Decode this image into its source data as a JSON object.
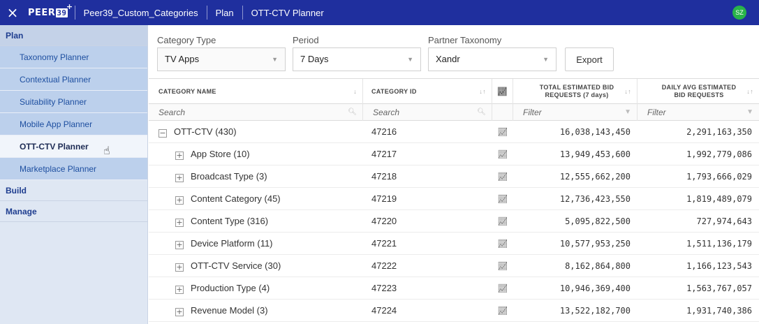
{
  "topbar": {
    "close_icon": "×",
    "logo_text": "PEER",
    "logo_num": "39",
    "logo_sup": "+",
    "crumbs": [
      "Peer39_Custom_Categories",
      "Plan",
      "OTT-CTV Planner"
    ],
    "avatar": "SZ",
    "colors": {
      "bar": "#1f2f9e",
      "avatar": "#29b34a"
    }
  },
  "sidebar": {
    "sections": [
      {
        "label": "Plan"
      },
      {
        "label": "Build"
      },
      {
        "label": "Manage"
      }
    ],
    "plan_items": [
      {
        "label": "Taxonomy Planner"
      },
      {
        "label": "Contextual Planner"
      },
      {
        "label": "Suitability Planner"
      },
      {
        "label": "Mobile App Planner"
      },
      {
        "label": "OTT-CTV Planner",
        "selected": true
      },
      {
        "label": "Marketplace Planner"
      }
    ]
  },
  "filters": {
    "category_type": {
      "label": "Category Type",
      "value": "TV Apps"
    },
    "period": {
      "label": "Period",
      "value": "7 Days"
    },
    "partner": {
      "label": "Partner Taxonomy",
      "value": "Xandr"
    },
    "export_label": "Export"
  },
  "grid": {
    "headers": {
      "name": "CATEGORY NAME",
      "id": "CATEGORY ID",
      "total": "TOTAL ESTIMATED BID REQUESTS (7 days)",
      "daily": "DAILY AVG ESTIMATED BID REQUESTS"
    },
    "placeholders": {
      "name": "Search",
      "id": "Search",
      "total": "Filter",
      "daily": "Filter"
    },
    "rows": [
      {
        "toggle": "−",
        "name": "OTT-CTV (430)",
        "id": "47216",
        "total": "16,038,143,450",
        "daily": "2,291,163,350"
      },
      {
        "toggle": "+",
        "name": "App Store (10)",
        "id": "47217",
        "total": "13,949,453,600",
        "daily": "1,992,779,086"
      },
      {
        "toggle": "+",
        "name": "Broadcast Type (3)",
        "id": "47218",
        "total": "12,555,662,200",
        "daily": "1,793,666,029"
      },
      {
        "toggle": "+",
        "name": "Content Category (45)",
        "id": "47219",
        "total": "12,736,423,550",
        "daily": "1,819,489,079"
      },
      {
        "toggle": "+",
        "name": "Content Type (316)",
        "id": "47220",
        "total": "5,095,822,500",
        "daily": "727,974,643"
      },
      {
        "toggle": "+",
        "name": "Device Platform (11)",
        "id": "47221",
        "total": "10,577,953,250",
        "daily": "1,511,136,179"
      },
      {
        "toggle": "+",
        "name": "OTT-CTV Service (30)",
        "id": "47222",
        "total": "8,162,864,800",
        "daily": "1,166,123,543"
      },
      {
        "toggle": "+",
        "name": "Production Type (4)",
        "id": "47223",
        "total": "10,946,369,400",
        "daily": "1,563,767,057"
      },
      {
        "toggle": "+",
        "name": "Revenue Model (3)",
        "id": "47224",
        "total": "13,522,182,700",
        "daily": "1,931,740,386"
      }
    ]
  }
}
